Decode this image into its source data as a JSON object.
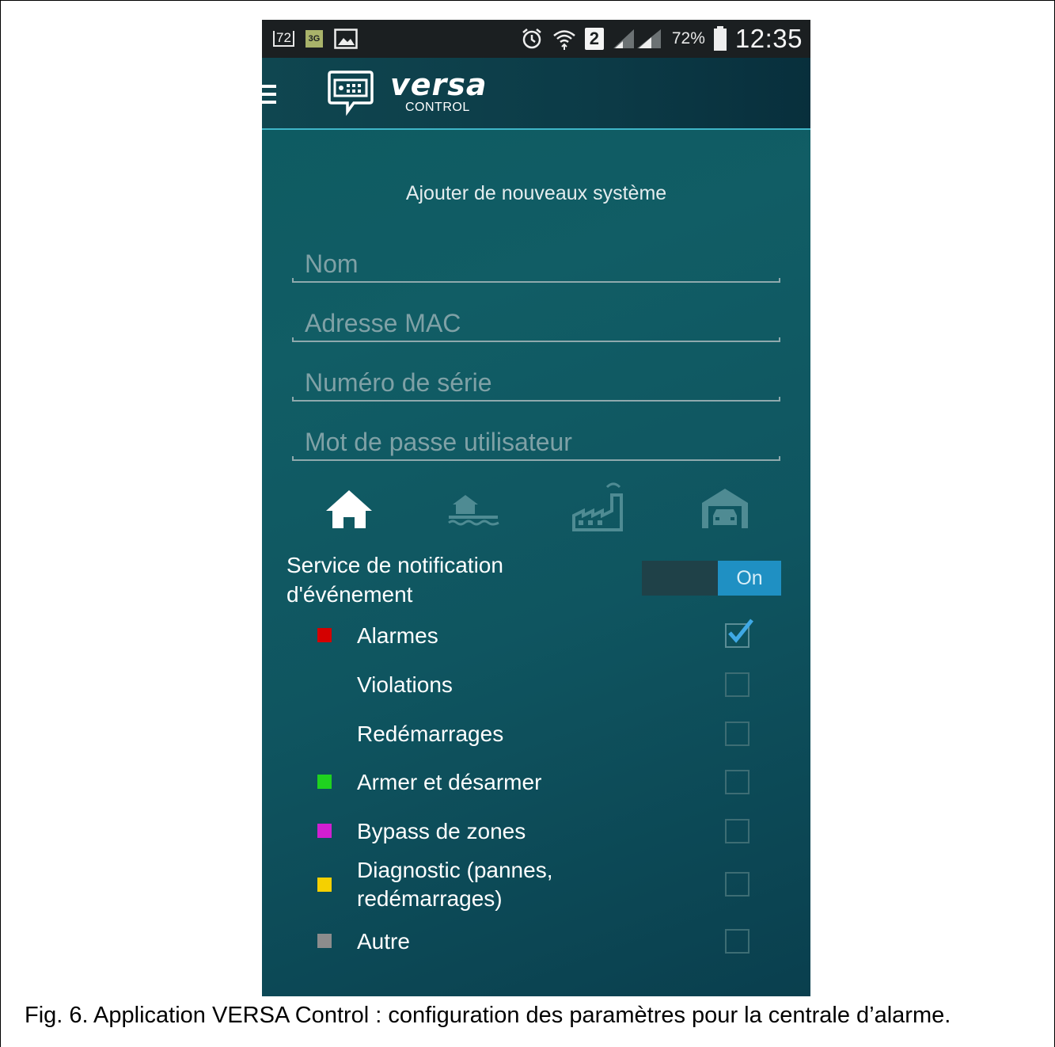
{
  "status_bar": {
    "notif_72": "72",
    "notif_3g": "3G",
    "sim_badge": "2",
    "battery_pct": "72%",
    "time": "12:35"
  },
  "app_bar": {
    "brand": "versa",
    "subtitle": "CONTROL"
  },
  "form": {
    "title": "Ajouter de nouveaux système",
    "fields": [
      {
        "placeholder": "Nom",
        "value": ""
      },
      {
        "placeholder": "Adresse MAC",
        "value": ""
      },
      {
        "placeholder": "Numéro de série",
        "value": ""
      },
      {
        "placeholder": "Mot de passe utilisateur",
        "value": ""
      }
    ],
    "system_types": [
      {
        "icon": "house-icon",
        "selected": true
      },
      {
        "icon": "lake-house-icon",
        "selected": false
      },
      {
        "icon": "factory-icon",
        "selected": false
      },
      {
        "icon": "garage-icon",
        "selected": false
      }
    ]
  },
  "notifications": {
    "label": "Service de notification d'événement",
    "toggle_state": "On",
    "events": [
      {
        "label": "Alarmes",
        "color": "#d40000",
        "checked": true
      },
      {
        "label": "Violations",
        "color": null,
        "checked": false
      },
      {
        "label": "Redémarrages",
        "color": null,
        "checked": false
      },
      {
        "label": "Armer et désarmer",
        "color": "#1fd21f",
        "checked": false
      },
      {
        "label": "Bypass de zones",
        "color": "#d11fd1",
        "checked": false
      },
      {
        "label": "Diagnostic (pannes, redémarrages)",
        "color": "#f5d000",
        "checked": false
      },
      {
        "label": "Autre",
        "color": "#8c8c8c",
        "checked": false
      }
    ]
  },
  "colors": {
    "accent_blue": "#1f90c3",
    "check_blue": "#3fa9e6",
    "app_bar_line": "#3fb6c8"
  },
  "caption": "Fig. 6. Application VERSA Control : configuration des paramètres pour la centrale d’alarme."
}
